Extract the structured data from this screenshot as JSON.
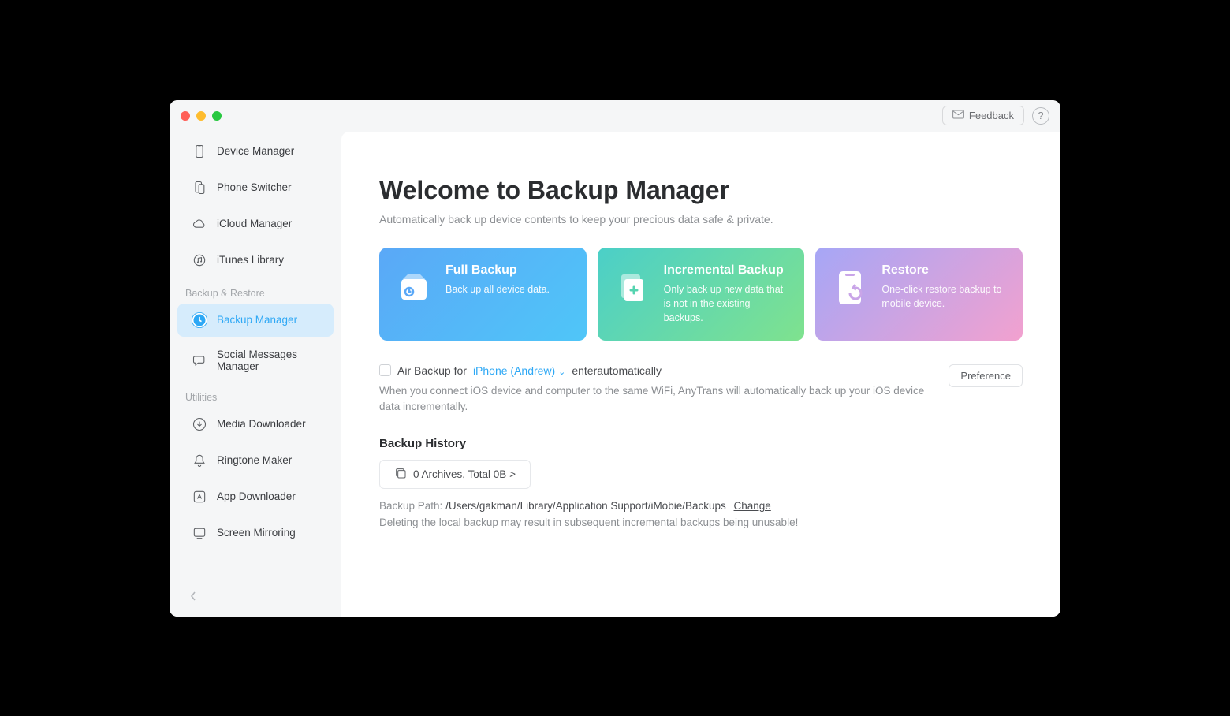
{
  "titlebar": {
    "feedback_label": "Feedback"
  },
  "sidebar": {
    "items": [
      {
        "label": "Device Manager"
      },
      {
        "label": "Phone Switcher"
      },
      {
        "label": "iCloud Manager"
      },
      {
        "label": "iTunes Library"
      }
    ],
    "section_backup": "Backup & Restore",
    "backup_items": [
      {
        "label": "Backup Manager"
      },
      {
        "label": "Social Messages Manager"
      }
    ],
    "section_utilities": "Utilities",
    "utility_items": [
      {
        "label": "Media Downloader"
      },
      {
        "label": "Ringtone Maker"
      },
      {
        "label": "App Downloader"
      },
      {
        "label": "Screen Mirroring"
      }
    ]
  },
  "main": {
    "title": "Welcome to Backup Manager",
    "subtitle": "Automatically back up device contents to keep your precious data safe & private.",
    "cards": [
      {
        "title": "Full Backup",
        "desc": "Back up all device data."
      },
      {
        "title": "Incremental Backup",
        "desc": "Only back up new data that is not in the existing backups."
      },
      {
        "title": "Restore",
        "desc": "One-click restore backup to mobile device."
      }
    ],
    "air": {
      "prefix": "Air Backup for",
      "device": "iPhone (Andrew)",
      "suffix": "enterautomatically",
      "desc": "When you connect iOS device and computer to the same WiFi, AnyTrans will automatically back up your iOS device data incrementally.",
      "pref_label": "Preference"
    },
    "history": {
      "heading": "Backup History",
      "archives": "0 Archives, Total  0B >",
      "path_label": "Backup Path: ",
      "path_value": "/Users/gakman/Library/Application Support/iMobie/Backups",
      "change_label": "Change",
      "warn": "Deleting the local backup may result in subsequent incremental backups being unusable!"
    }
  }
}
